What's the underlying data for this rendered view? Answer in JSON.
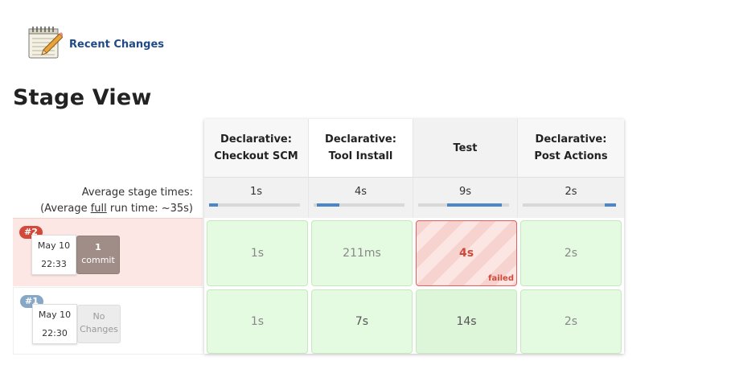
{
  "recent_changes": {
    "label": "Recent Changes"
  },
  "page_title": "Stage View",
  "averages": {
    "label": "Average stage times:",
    "full_prefix": "(Average ",
    "full_word": "full",
    "full_suffix": " run time: ~35s)"
  },
  "stages": [
    {
      "line1": "Declarative:",
      "line2": "Checkout SCM",
      "avg": "1s",
      "avg_fraction": 0.1
    },
    {
      "line1": "Declarative:",
      "line2": "Tool Install",
      "avg": "4s",
      "avg_fraction": 0.25
    },
    {
      "line1": "",
      "line2": "Test",
      "avg": "9s",
      "avg_fraction": 0.6
    },
    {
      "line1": "Declarative:",
      "line2": "Post Actions",
      "avg": "2s",
      "avg_fraction": 0.12
    }
  ],
  "builds": [
    {
      "badge": "#2",
      "date": "May 10",
      "time": "22:33",
      "changes_count": "1",
      "changes_label": "commit",
      "status": "failed",
      "cells": [
        "1s",
        "211ms",
        "4s",
        "2s"
      ],
      "failed_label": "failed"
    },
    {
      "badge": "#1",
      "date": "May 10",
      "time": "22:30",
      "changes_line1": "No",
      "changes_line2": "Changes",
      "status": "success",
      "cells": [
        "1s",
        "7s",
        "14s",
        "2s"
      ]
    }
  ],
  "colors": {
    "success": "#e5fbe1",
    "failed": "#d24939",
    "failed_row": "#fde7e4",
    "progress": "#4b86c8",
    "link": "#204a87"
  },
  "icons": {
    "recent_changes": "notepad-icon"
  }
}
